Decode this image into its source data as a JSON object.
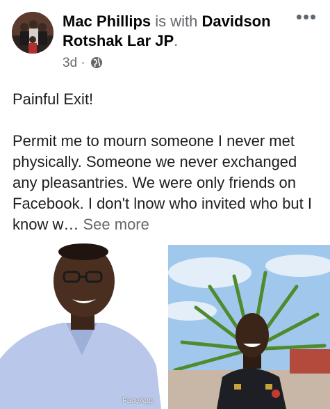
{
  "post": {
    "author": "Mac Phillips",
    "with_text": "is with",
    "tagged": "Davidson Rotshak Lar JP",
    "time": "3d",
    "separator": "·",
    "privacy_icon": "globe-icon",
    "more_icon": "more-options-icon",
    "title_line": "Painful Exit!",
    "body": "Permit me to mourn someone I never met physically. Someone we never exchanged any pleasantries. We were only friends on Facebook. I don't lnow who invited who but I know w…",
    "see_more": "See more"
  },
  "photos": {
    "watermark": "FaceApp"
  },
  "colors": {
    "text": "#1c1e21",
    "secondary": "#65676b",
    "shirt": "#b9c8ea",
    "uniform": "#1d1f24",
    "sky": "#9fc8ec",
    "palm": "#4f8a2c"
  }
}
